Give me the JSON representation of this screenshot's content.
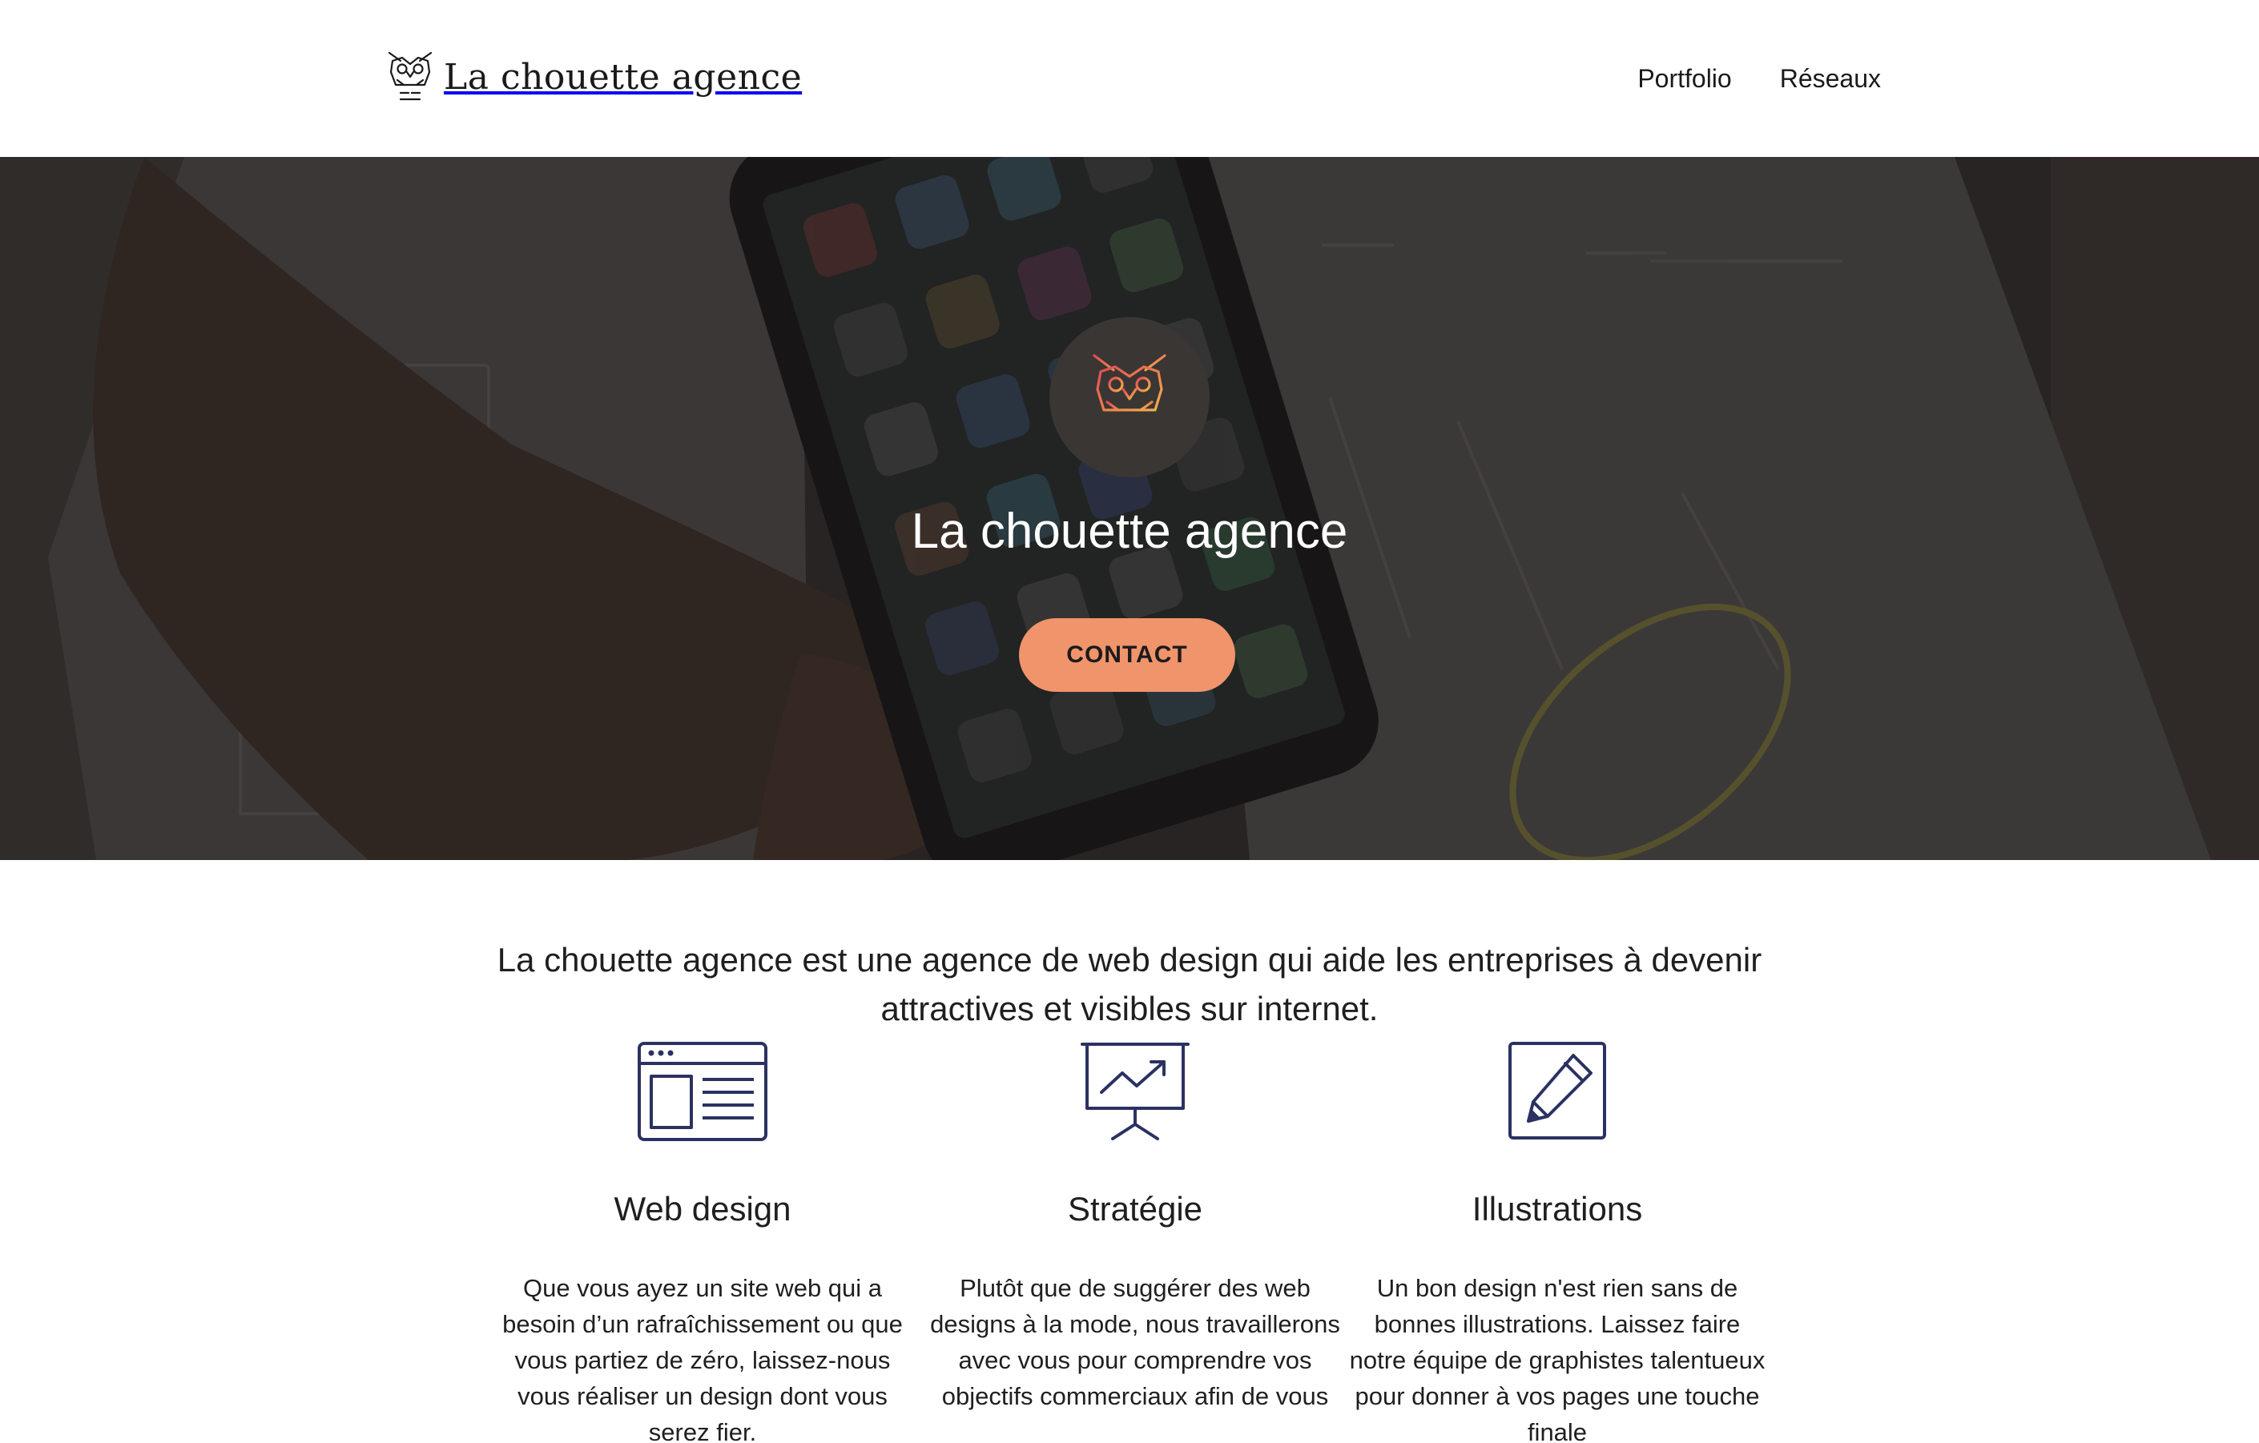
{
  "header": {
    "brand_name": "La chouette agence",
    "nav": [
      "Portfolio",
      "Réseaux"
    ]
  },
  "hero": {
    "title": "La chouette agence",
    "cta_label": "CONTACT"
  },
  "intro": {
    "text": "La chouette agence est une agence de web design qui aide les entreprises à devenir attractives et visibles sur internet."
  },
  "services": [
    {
      "icon": "browser-window-icon",
      "title": "Web design",
      "description": "Que vous ayez un site web qui a besoin d’un rafraîchissement ou que vous partiez de zéro, laissez-nous vous réaliser un design dont vous serez fier."
    },
    {
      "icon": "presentation-chart-icon",
      "title": "Stratégie",
      "description": "Plutôt que de suggérer des web designs à la mode, nous travaillerons avec vous pour comprendre vos objectifs commerciaux afin de vous"
    },
    {
      "icon": "pencil-square-icon",
      "title": "Illustrations",
      "description": "Un bon design n'est rien sans de bonnes illustrations. Laissez faire notre équipe de graphistes talentueux pour donner à vos pages une touche finale"
    }
  ],
  "colors": {
    "accent": "#f0946b",
    "icon_navy": "#2b3262",
    "hero_overlay": "#2c2826",
    "text": "#1f1f1f"
  }
}
